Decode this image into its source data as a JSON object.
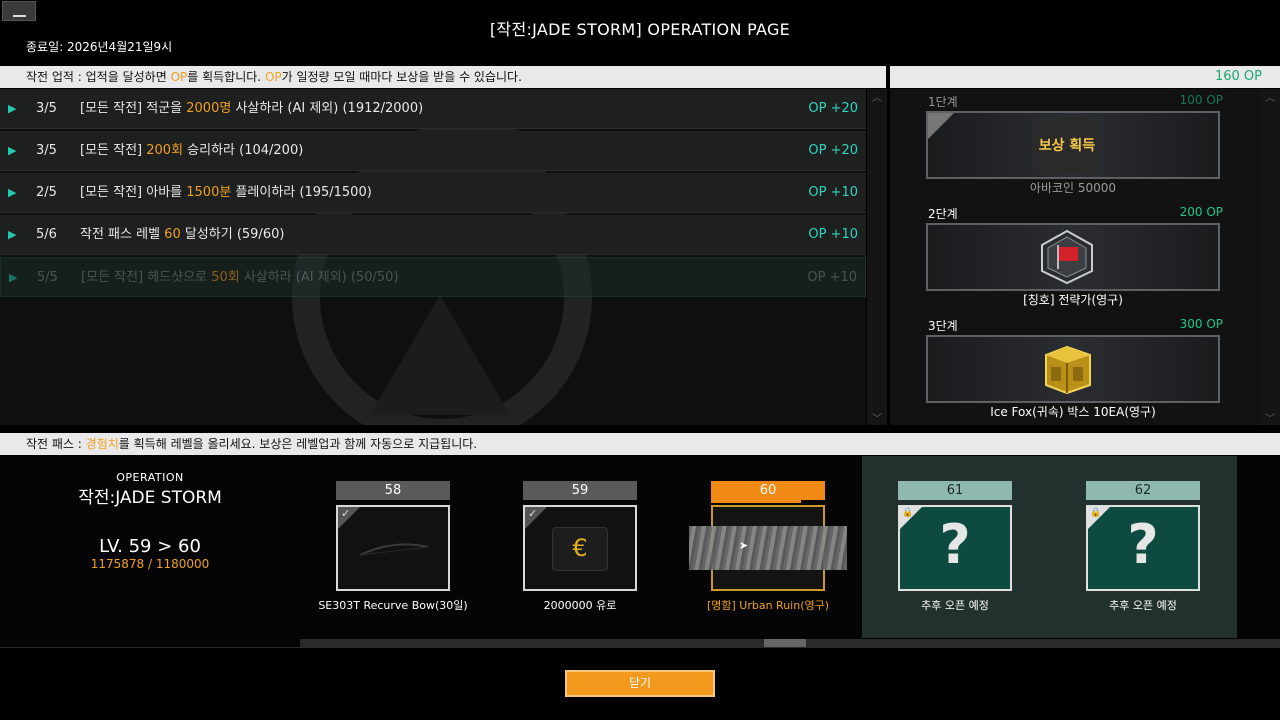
{
  "window": {
    "title": "[작전:JADE STORM] OPERATION PAGE",
    "end_date": "종료일: 2026년4월21일9시"
  },
  "achievements": {
    "header": {
      "prefix": "작전 업적 : 업적을 달성하면 ",
      "op1": "OP",
      "mid": "를 획득합니다. ",
      "op2": "OP",
      "suffix": "가 일정량 모일 때마다 보상을 받을 수 있습니다."
    },
    "rows": [
      {
        "progress": "3/5",
        "pre": "[모든 작전] 적군을 ",
        "hl": "2000명",
        "post": " 사살하라 (AI 제외) (1912/2000)",
        "op": "OP +20"
      },
      {
        "progress": "3/5",
        "pre": "[모든 작전] ",
        "hl": "200회",
        "post": " 승리하라 (104/200)",
        "op": "OP +20"
      },
      {
        "progress": "2/5",
        "pre": "[모든 작전] 아바를 ",
        "hl": "1500분",
        "post": " 플레이하라 (195/1500)",
        "op": "OP +10"
      },
      {
        "progress": "5/6",
        "pre": "작전 패스 레벨 ",
        "hl": "60",
        "post": " 달성하기 (59/60)",
        "op": "OP +10"
      },
      {
        "progress": "5/5",
        "pre": "[모든 작전] 헤드샷으로 ",
        "hl": "50회",
        "post": " 사살하라 (AI 제외) (50/50)",
        "op": "OP +10"
      }
    ]
  },
  "rewards": {
    "op_total": "160 OP",
    "stages": [
      {
        "name": "1단계",
        "op": "100 OP",
        "label": "아바코인 50000",
        "claim": "보상 획득"
      },
      {
        "name": "2단계",
        "op": "200 OP",
        "label": "[칭호] 전략가(영구)"
      },
      {
        "name": "3단계",
        "op": "300 OP",
        "label": "Ice Fox(귀속) 박스 10EA(영구)"
      }
    ]
  },
  "pass": {
    "header": {
      "prefix": "작전 패스 : ",
      "hl": "경험치",
      "suffix": "를 획득해 레벨을 올리세요. 보상은 레벨업과 함께 자동으로 지급됩니다."
    },
    "operation_label": "OPERATION",
    "operation_name": "작전:JADE STORM",
    "level_text": "LV. 59 > 60",
    "exp_text": "1175878 / 1180000",
    "levels": [
      {
        "level": "58",
        "label": "SE303T Recurve Bow(30일)",
        "state": "claimed"
      },
      {
        "level": "59",
        "label": "2000000 유로",
        "state": "claimed"
      },
      {
        "level": "60",
        "label": "[명함] Urban Ruin(영구)",
        "state": "current"
      },
      {
        "level": "61",
        "label": "추후 오픈 예정",
        "state": "locked"
      },
      {
        "level": "62",
        "label": "추후 오픈 예정",
        "state": "locked"
      }
    ],
    "locked_symbol": "?",
    "euro_symbol": "€"
  },
  "footer": {
    "close_label": "닫기"
  },
  "colors": {
    "accent_orange": "#f08a14",
    "op_green": "#1ec78f",
    "highlight": "#f0a020",
    "teal_locked": "#0d4a40"
  }
}
